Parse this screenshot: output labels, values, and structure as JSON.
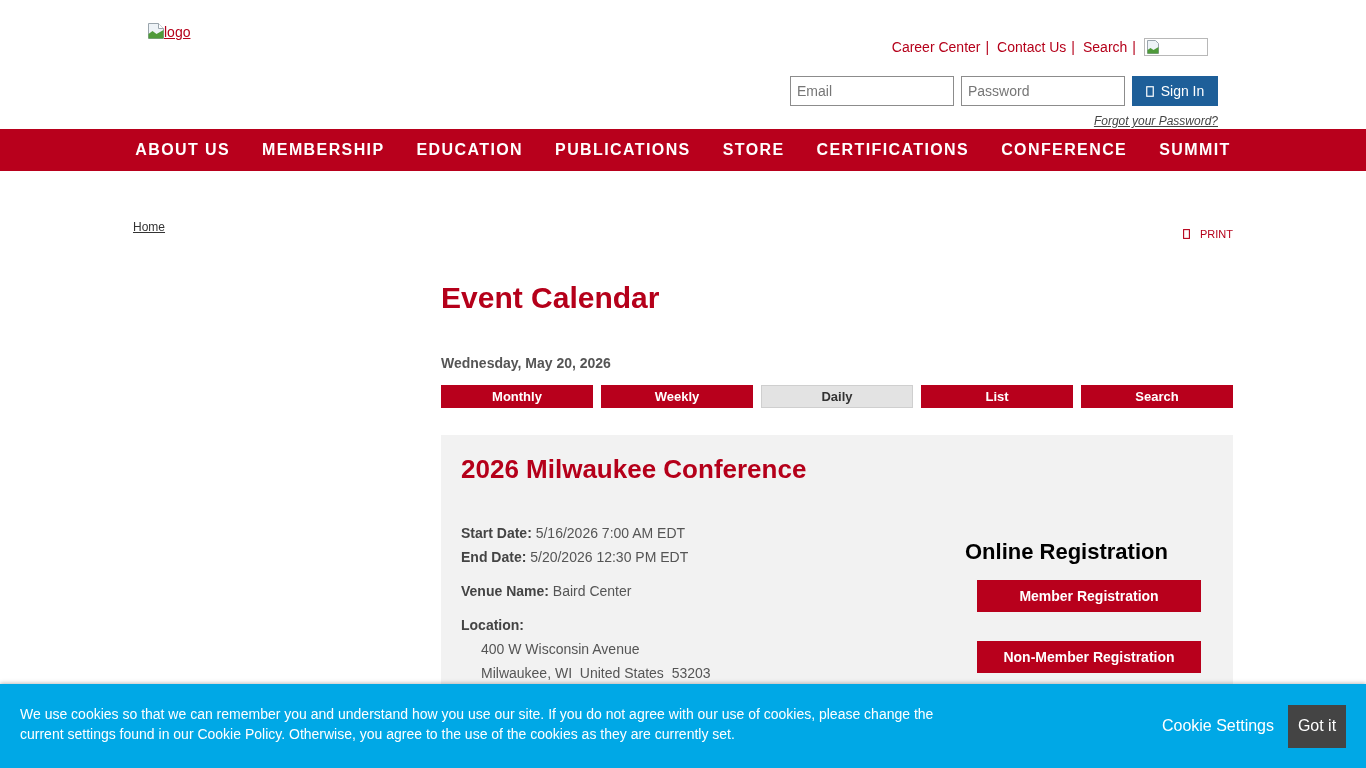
{
  "header": {
    "logo": {
      "alt_text": "logo"
    },
    "top_links": [
      {
        "label": "Career Center",
        "separator": "|"
      },
      {
        "label": "Contact Us",
        "separator": "|"
      },
      {
        "label": "Search",
        "separator": "|"
      }
    ],
    "login": {
      "email_placeholder": "Email",
      "password_placeholder": "Password",
      "sign_in_button": "Sign In",
      "forgot_password_link": "Forgot your Password?"
    }
  },
  "nav": [
    "ABOUT US",
    "MEMBERSHIP",
    "EDUCATION",
    "PUBLICATIONS",
    "STORE",
    "CERTIFICATIONS",
    "CONFERENCE",
    "SUMMIT"
  ],
  "breadcrumb": [
    "Home"
  ],
  "print_link": "PRINT",
  "page_title": "Event Calendar",
  "calendar": {
    "date": "Wednesday, May 20, 2026",
    "view_tabs": [
      {
        "label": "Monthly",
        "selected": false
      },
      {
        "label": "Weekly",
        "selected": false
      },
      {
        "label": "Daily",
        "selected": true
      },
      {
        "label": "List",
        "selected": false
      },
      {
        "label": "Search",
        "selected": false
      }
    ]
  },
  "event": {
    "title": "2026 Milwaukee Conference",
    "dates": [
      "**Start Date:** 5/16/2026 7:00 AM EDT",
      "**End Date:** 5/20/2026 12:30 PM EDT"
    ],
    "venue": "**Venue Name:** Baird Center",
    "location": {
      "label": "Location:",
      "lines": [
        "400 W Wisconsin Avenue",
        "Milwaukee, WI  United States  53203"
      ]
    },
    "registration": {
      "title": "Online Registration",
      "buttons": [
        "Member Registration",
        "Non-Member Registration"
      ]
    }
  },
  "cookie_banner": {
    "message": "We use cookies so that we can remember you and understand how you use our site. If you do not agree with our use of cookies, please change the current settings found in our Cookie Policy. Otherwise, you agree to the use of the cookies as they are currently set.",
    "settings_link": "Cookie Settings",
    "accept_button": "Got it"
  }
}
